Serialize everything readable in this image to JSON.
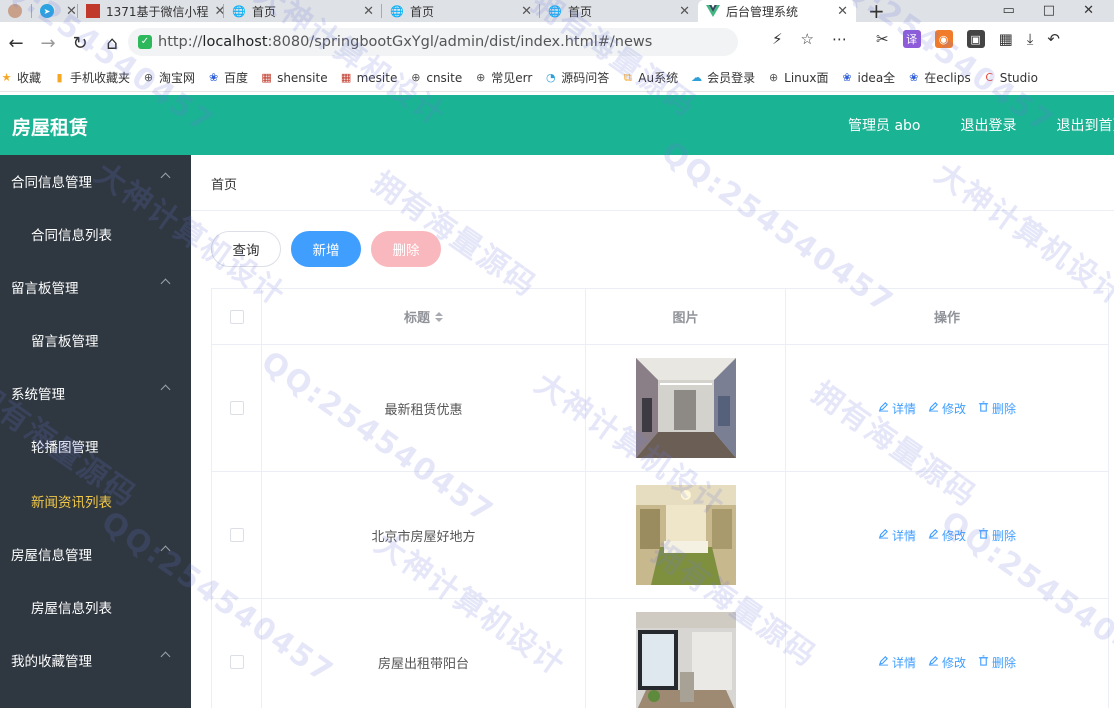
{
  "browser": {
    "tabs": [
      {
        "label": "",
        "icon": "avatar-icon"
      },
      {
        "label": "",
        "icon": "telegram-icon"
      },
      {
        "label": "1371基于微信小程",
        "icon": "site-icon"
      },
      {
        "label": "首页",
        "icon": "globe-icon"
      },
      {
        "label": "首页",
        "icon": "globe-icon"
      },
      {
        "label": "首页",
        "icon": "globe-icon"
      },
      {
        "label": "后台管理系统",
        "icon": "vue-icon",
        "active": true
      }
    ],
    "url_scheme": "http://",
    "url_host": "localhost",
    "url_rest": ":8080/springbootGxYgl/admin/dist/index.html#/news",
    "bookmarks": [
      {
        "label": "收藏",
        "icon": "star-icon",
        "color": "#f5a623"
      },
      {
        "label": "手机收藏夹",
        "icon": "phone-icon",
        "color": "#f5a623"
      },
      {
        "label": "淘宝网",
        "icon": "globe-icon",
        "color": "#555555"
      },
      {
        "label": "百度",
        "icon": "paw-icon",
        "color": "#2f5fd8"
      },
      {
        "label": "shensite",
        "icon": "site-icon",
        "color": "#c0392b"
      },
      {
        "label": "mesite",
        "icon": "site-icon",
        "color": "#c0392b"
      },
      {
        "label": "cnsite",
        "icon": "globe-icon",
        "color": "#555555"
      },
      {
        "label": "常见err",
        "icon": "globe-icon",
        "color": "#555555"
      },
      {
        "label": "源码问答",
        "icon": "qa-icon",
        "color": "#2f9fd8"
      },
      {
        "label": "Au系统",
        "icon": "au-icon",
        "color": "#f5a623"
      },
      {
        "label": "会员登录",
        "icon": "cloud-icon",
        "color": "#2f9fd8"
      },
      {
        "label": "Linux面",
        "icon": "globe-icon",
        "color": "#555555"
      },
      {
        "label": "idea全",
        "icon": "paw-icon",
        "color": "#2f5fd8"
      },
      {
        "label": "在eclips",
        "icon": "paw-icon",
        "color": "#2f5fd8"
      },
      {
        "label": "Studio",
        "icon": "studio-icon",
        "color": "#e74c3c"
      }
    ]
  },
  "header": {
    "title": "房屋租赁",
    "admin": "管理员 abo",
    "logout": "退出登录",
    "exit_home": "退出到首页"
  },
  "sidebar": {
    "groups": [
      {
        "label": "合同信息管理",
        "items": [
          {
            "label": "合同信息列表",
            "active": false
          }
        ]
      },
      {
        "label": "留言板管理",
        "items": [
          {
            "label": "留言板管理",
            "active": false
          }
        ]
      },
      {
        "label": "系统管理",
        "items": [
          {
            "label": "轮播图管理",
            "active": false
          },
          {
            "label": "新闻资讯列表",
            "active": true
          }
        ]
      },
      {
        "label": "房屋信息管理",
        "items": [
          {
            "label": "房屋信息列表",
            "active": false
          }
        ]
      },
      {
        "label": "我的收藏管理",
        "items": []
      }
    ]
  },
  "main": {
    "breadcrumb": "首页",
    "buttons": {
      "query": "查询",
      "add": "新增",
      "delete": "删除"
    },
    "table": {
      "columns": [
        "标题",
        "图片",
        "操作"
      ],
      "rows": [
        {
          "title": "最新租赁优惠",
          "image": "room-1"
        },
        {
          "title": "北京市房屋好地方",
          "image": "room-2"
        },
        {
          "title": "房屋出租带阳台",
          "image": "room-3"
        }
      ],
      "actions": {
        "detail": "详情",
        "edit": "修改",
        "delete": "删除"
      }
    }
  },
  "watermarks": [
    "QQ:254540457",
    "大神计算机设计",
    "拥有海量源码"
  ],
  "colors": {
    "header": "#1ab394",
    "sidebar": "#2f3740",
    "active_menu": "#f0c84a",
    "primary": "#409eff",
    "danger_light": "#f9b8bd"
  }
}
